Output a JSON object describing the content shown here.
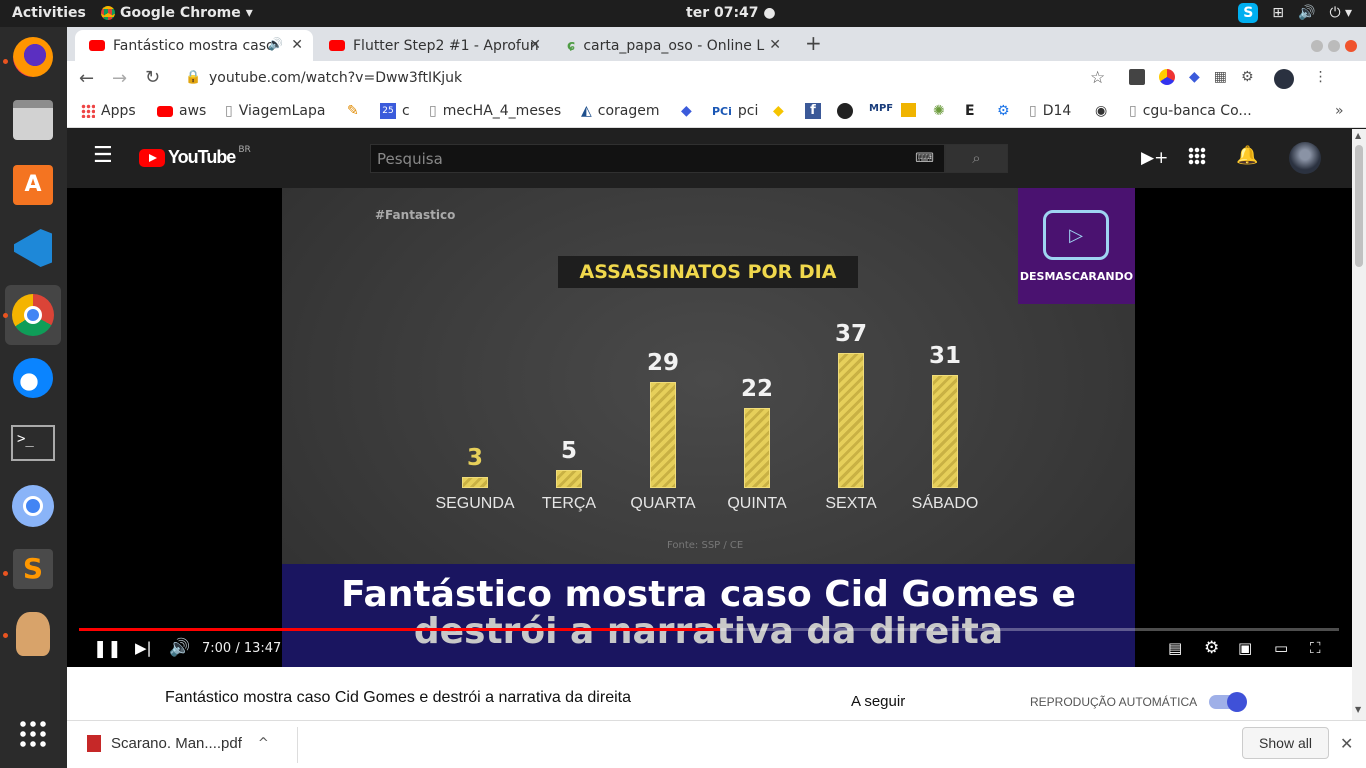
{
  "topbar": {
    "activities": "Activities",
    "app_name": "Google Chrome",
    "clock": "ter 07:47"
  },
  "tabs": [
    {
      "title": "Fantástico mostra caso",
      "icon": "youtube-icon",
      "active": true
    },
    {
      "title": "Flutter Step2 #1 - Aprofun",
      "icon": "youtube-icon",
      "active": false
    },
    {
      "title": "carta_papa_oso - Online L",
      "icon": "overleaf-icon",
      "active": false
    }
  ],
  "address": {
    "url": "youtube.com/watch?v=Dww3ftIKjuk"
  },
  "bookmarks": [
    {
      "label": "Apps",
      "icon": "apps-grid-icon"
    },
    {
      "label": "aws",
      "icon": "youtube-icon"
    },
    {
      "label": "ViagemLapa",
      "icon": "page-icon"
    },
    {
      "label": "",
      "icon": "pencil-icon"
    },
    {
      "label": "c",
      "icon": "calendar-icon"
    },
    {
      "label": "mecHA_4_meses",
      "icon": "page-icon"
    },
    {
      "label": "coragem",
      "icon": "triangle-icon"
    },
    {
      "label": "",
      "icon": "diamond-icon"
    },
    {
      "label": "pci",
      "icon": "pci-icon"
    },
    {
      "label": "",
      "icon": "bb-icon"
    },
    {
      "label": "",
      "icon": "facebook-icon"
    },
    {
      "label": "",
      "icon": "github-icon"
    },
    {
      "label": "",
      "icon": "mpf-icon"
    },
    {
      "label": "",
      "icon": "box-icon"
    },
    {
      "label": "",
      "icon": "seal-icon"
    },
    {
      "label": "",
      "icon": "e-icon"
    },
    {
      "label": "",
      "icon": "gear-circle-icon"
    },
    {
      "label": "D14",
      "icon": "page-icon"
    },
    {
      "label": "",
      "icon": "globe-icon"
    },
    {
      "label": "cgu-banca Co...",
      "icon": "page-icon"
    }
  ],
  "youtube": {
    "logo_text": "YouTube",
    "logo_region": "BR",
    "search_placeholder": "Pesquisa"
  },
  "video": {
    "hashtag": "#Fantastico",
    "channel_badge": "DESMASCARANDO",
    "caption_line1": "Fantástico mostra caso Cid Gomes e",
    "caption_line2": "destrói a narrativa da direita",
    "source": "Fonte: SSP / CE",
    "time_display": "7:00 / 13:47",
    "progress_fraction": 0.509
  },
  "chart_data": {
    "type": "bar",
    "title": "ASSASSINATOS POR DIA",
    "categories": [
      "SEGUNDA",
      "TERÇA",
      "QUARTA",
      "QUINTA",
      "SEXTA",
      "SÁBADO"
    ],
    "values": [
      3,
      5,
      29,
      22,
      37,
      31
    ],
    "ylim": [
      0,
      37
    ],
    "colors": {
      "bar": "#e6cf5a",
      "background": "#3a3a3a"
    }
  },
  "below": {
    "title": "Fantástico mostra caso Cid Gomes e destrói a narrativa da direita",
    "up_next": "A seguir",
    "autoplay_label": "REPRODUÇÃO AUTOMÁTICA",
    "autoplay_on": true
  },
  "download": {
    "file": "Scarano. Man....pdf",
    "show_all": "Show all"
  },
  "colors": {
    "accent_red": "#ff0000",
    "toggle_blue": "#3ea6ff"
  }
}
